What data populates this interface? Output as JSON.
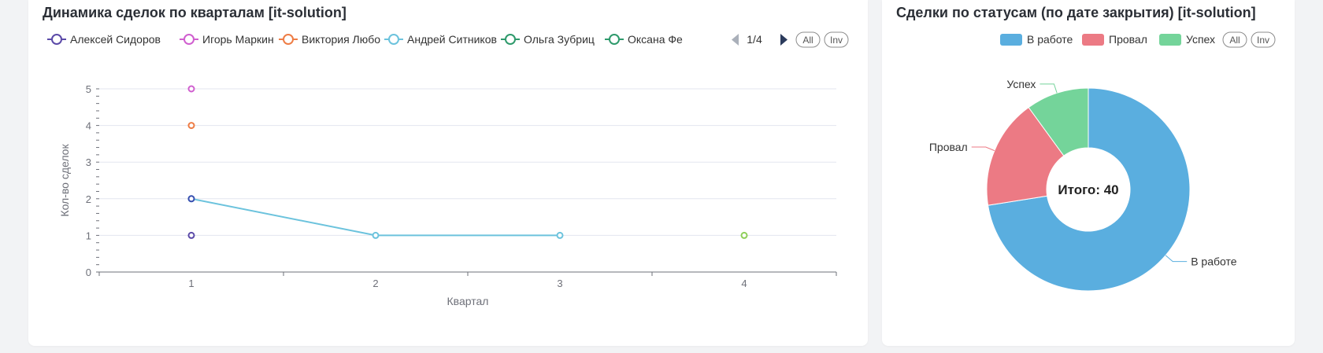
{
  "left_card": {
    "title": "Динамика сделок по кварталам [it-solution]",
    "legend": {
      "items": [
        {
          "label": "Алексей Сидоров",
          "color": "#5b4aa8"
        },
        {
          "label": "Игорь Маркин",
          "color": "#d05fcf"
        },
        {
          "label": "Виктория Любо",
          "color": "#ee7d46"
        },
        {
          "label": "Андрей Ситников",
          "color": "#6cc3dd"
        },
        {
          "label": "Ольга Зубриц",
          "color": "#2f9a6c"
        },
        {
          "label": "Оксана Фе",
          "color": "#2f9a6c"
        }
      ],
      "page_indicator": "1/4",
      "all_label": "All",
      "inv_label": "Inv"
    }
  },
  "right_card": {
    "title": "Сделки по статусам (по дате закрытия) [it-solution]",
    "legend": {
      "items": [
        {
          "label": "В работе",
          "color": "#5aaedf"
        },
        {
          "label": "Провал",
          "color": "#ec7a84"
        },
        {
          "label": "Успех",
          "color": "#74d49a"
        }
      ],
      "all_label": "All",
      "inv_label": "Inv"
    },
    "center_label": "Итого: 40"
  },
  "chart_data": [
    {
      "type": "line",
      "title": "Динамика сделок по кварталам [it-solution]",
      "xlabel": "Квартал",
      "ylabel": "Кол-во сделок",
      "categories": [
        "1",
        "2",
        "3",
        "4"
      ],
      "ylim": [
        0,
        5
      ],
      "yticks": [
        "0",
        "1",
        "2",
        "3",
        "4",
        "5"
      ],
      "grid": true,
      "legend_position": "top",
      "series": [
        {
          "name": "Алексей Сидоров",
          "color": "#5b4aa8",
          "values": [
            1,
            null,
            null,
            null
          ]
        },
        {
          "name": "Игорь Маркин",
          "color": "#d05fcf",
          "values": [
            5,
            null,
            null,
            null
          ]
        },
        {
          "name": "Виктория Любо",
          "color": "#ee7d46",
          "values": [
            4,
            null,
            null,
            null
          ]
        },
        {
          "name": "Андрей Ситников",
          "color": "#6cc3dd",
          "values": [
            2,
            1,
            1,
            null
          ]
        },
        {
          "name": "Ольга Зубриц",
          "color": "#2f9a6c",
          "values": [
            null,
            null,
            null,
            null
          ]
        },
        {
          "name": "Оксана Фе",
          "color": "#2f9a6c",
          "values": [
            null,
            null,
            null,
            null
          ]
        },
        {
          "name": "",
          "color": "#3a4fb0",
          "values": [
            2,
            null,
            null,
            null
          ]
        },
        {
          "name": "",
          "color": "#8fcf5a",
          "values": [
            null,
            null,
            null,
            1
          ]
        }
      ]
    },
    {
      "type": "pie",
      "title": "Сделки по статусам (по дате закрытия) [it-solution]",
      "donut": true,
      "total_label": "Итого: 40",
      "legend_position": "top-right",
      "slices": [
        {
          "label": "В работе",
          "value": 29,
          "color": "#5aaedf"
        },
        {
          "label": "Провал",
          "value": 7,
          "color": "#ec7a84"
        },
        {
          "label": "Успех",
          "value": 4,
          "color": "#74d49a"
        }
      ]
    }
  ]
}
